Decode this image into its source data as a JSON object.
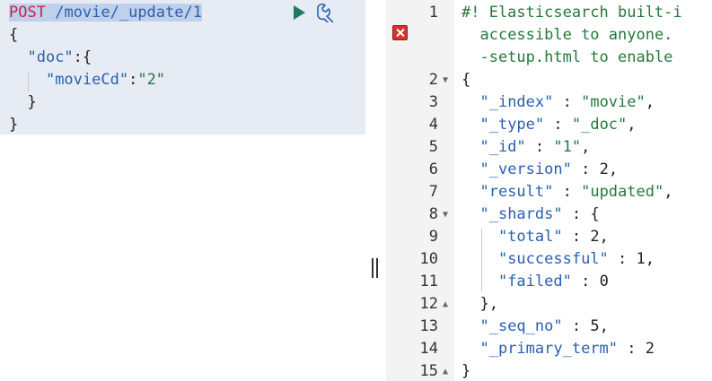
{
  "request": {
    "method": "POST",
    "url": "/movie/_update/1",
    "body": [
      {
        "text": "{"
      },
      {
        "key": "\"doc\"",
        "after": ":{"
      },
      {
        "key": "\"movieCd\"",
        "sep": ":",
        "value": "\"2\""
      },
      {
        "text": "}"
      },
      {
        "text": "}"
      }
    ]
  },
  "toolbar": {
    "run_icon": "play-icon",
    "settings_icon": "wrench-icon"
  },
  "response": {
    "line_numbers": [
      "1",
      "2",
      "3",
      "4",
      "5",
      "6",
      "7",
      "8",
      "9",
      "10",
      "11",
      "12",
      "13",
      "14",
      "15"
    ],
    "warning_lines": [
      "#! Elasticsearch built-i",
      "accessible to anyone.",
      "-setup.html to enable"
    ],
    "open_brace": "{",
    "close_brace": "}",
    "index_key": "\"_index\"",
    "index_val": "\"movie\"",
    "type_key": "\"_type\"",
    "type_val": "\"_doc\"",
    "id_key": "\"_id\"",
    "id_val": "\"1\"",
    "version_key": "\"_version\"",
    "version_val": "2",
    "result_key": "\"result\"",
    "result_val": "\"updated\"",
    "shards_key": "\"_shards\"",
    "total_key": "\"total\"",
    "total_val": "2",
    "successful_key": "\"successful\"",
    "successful_val": "1",
    "failed_key": "\"failed\"",
    "failed_val": "0",
    "shards_close": "},",
    "seq_key": "\"_seq_no\"",
    "seq_val": "5",
    "term_key": "\"_primary_term\"",
    "term_val": "2"
  },
  "colors": {
    "method": "#c7254e",
    "key": "#2960b0",
    "string": "#25793c",
    "error": "#d9332c"
  }
}
